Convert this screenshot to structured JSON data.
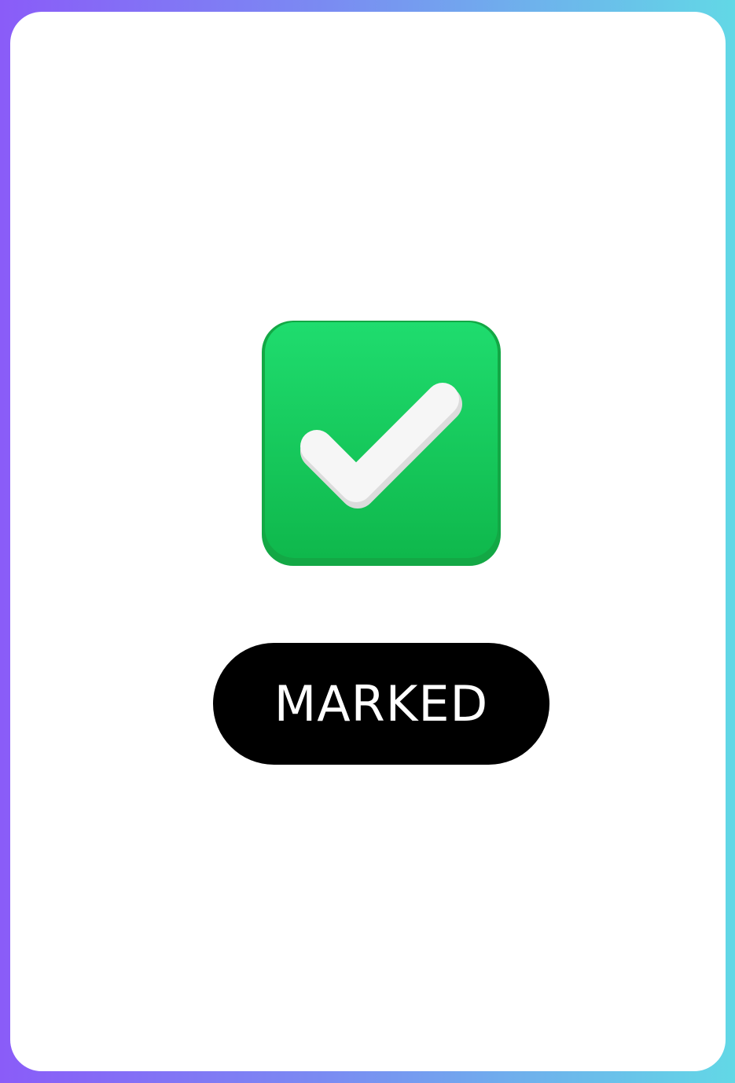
{
  "status": {
    "label": "MARKED",
    "icon": "check-square-icon",
    "icon_color": "#12c85a"
  }
}
